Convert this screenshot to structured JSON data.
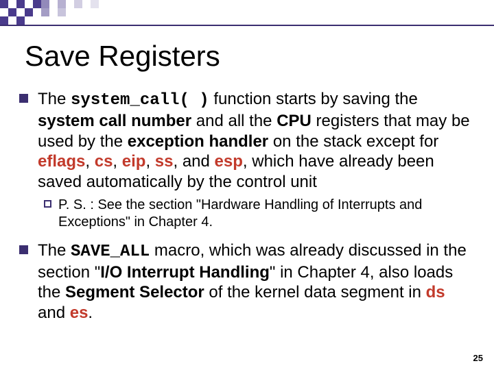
{
  "title": "Save Registers",
  "b1": {
    "t0": "The ",
    "code1": "system_call( )",
    "t1": " function starts by saving the ",
    "bold1": "system call number",
    "t2": " and all the ",
    "bold2": "CPU",
    "t3": " registers that may be used by the ",
    "bold3": "exception handler",
    "t4": " on the stack except for ",
    "r1": "eflags",
    "c1": ", ",
    "r2": "cs",
    "c2": ", ",
    "r3": "eip",
    "c3": ", ",
    "r4": "ss",
    "c4": ", and ",
    "r5": "esp",
    "t5": ", which have already been saved automatically by the control unit"
  },
  "sub1": {
    "t0": "P. S. : See the section \"Hardware Handling of Interrupts and Exceptions\" in Chapter 4."
  },
  "b2": {
    "t0": "The ",
    "code1": "SAVE_ALL",
    "t1": " macro, which was already discussed in the section \"",
    "bold1": "I/O Interrupt Handling",
    "t2": "\" in Chapter 4, also loads the ",
    "bold2": "Segment Selector",
    "t3": " of the kernel data segment in ",
    "r1": "ds",
    "c1": " and ",
    "r2": "es",
    "t4": "."
  },
  "slidenum": "25"
}
